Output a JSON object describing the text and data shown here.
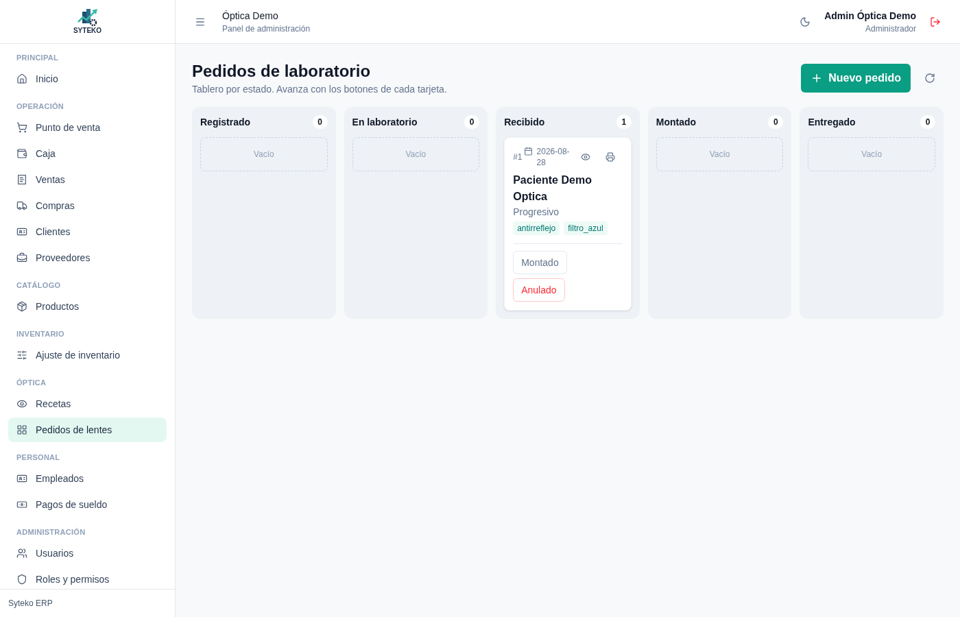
{
  "sidebar": {
    "logo_text": "SYTEKO",
    "sections": [
      {
        "label": "PRINCIPAL",
        "items": [
          {
            "label": "Inicio",
            "selected": false
          }
        ]
      },
      {
        "label": "OPERACIÓN",
        "items": [
          {
            "label": "Punto de venta",
            "selected": false
          },
          {
            "label": "Caja",
            "selected": false
          },
          {
            "label": "Ventas",
            "selected": false
          },
          {
            "label": "Compras",
            "selected": false
          },
          {
            "label": "Clientes",
            "selected": false
          },
          {
            "label": "Proveedores",
            "selected": false
          }
        ]
      },
      {
        "label": "CATÁLOGO",
        "items": [
          {
            "label": "Productos",
            "selected": false
          }
        ]
      },
      {
        "label": "INVENTARIO",
        "items": [
          {
            "label": "Ajuste de inventario",
            "selected": false
          }
        ]
      },
      {
        "label": "ÓPTICA",
        "items": [
          {
            "label": "Recetas",
            "selected": false
          },
          {
            "label": "Pedidos de lentes",
            "selected": true
          }
        ]
      },
      {
        "label": "PERSONAL",
        "items": [
          {
            "label": "Empleados",
            "selected": false
          },
          {
            "label": "Pagos de sueldo",
            "selected": false
          }
        ]
      },
      {
        "label": "ADMINISTRACIÓN",
        "items": [
          {
            "label": "Usuarios",
            "selected": false
          },
          {
            "label": "Roles y permisos",
            "selected": false
          }
        ]
      }
    ],
    "footer": "Syteko ERP"
  },
  "header": {
    "title": "Óptica Demo",
    "subtitle": "Panel de administración",
    "user_name": "Admin Óptica Demo",
    "user_role": "Administrador"
  },
  "page": {
    "title": "Pedidos de laboratorio",
    "subtitle": "Tablero por estado. Avanza con los botones de cada tarjeta.",
    "new_button": "Nuevo pedido"
  },
  "columns": [
    {
      "title": "Registrado",
      "count": "0",
      "empty_text": "Vacío"
    },
    {
      "title": "En laboratorio",
      "count": "0",
      "empty_text": "Vacío"
    },
    {
      "title": "Recibido",
      "count": "1",
      "cards": [
        {
          "number": "#1",
          "date": "2026-08-28",
          "patient": "Paciente Demo Optica",
          "lens_type": "Progresivo",
          "tags": [
            "antirreflejo",
            "filtro_azul"
          ],
          "actions": [
            {
              "label": "Montado",
              "kind": "advance"
            },
            {
              "label": "Anulado",
              "kind": "cancel"
            }
          ]
        }
      ]
    },
    {
      "title": "Montado",
      "count": "0",
      "empty_text": "Vacío"
    },
    {
      "title": "Entregado",
      "count": "0",
      "empty_text": "Vacío"
    }
  ]
}
